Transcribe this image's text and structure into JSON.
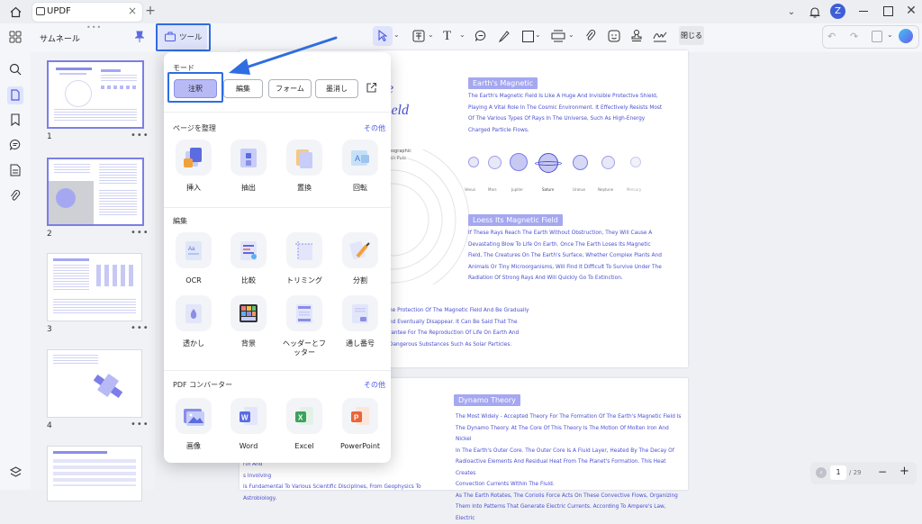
{
  "tab": {
    "title": "UPDF"
  },
  "window": {
    "avatar_letter": "Z"
  },
  "toolbar": {
    "tool_label": "ツール",
    "close_label": "閉じる"
  },
  "thumb_panel": {
    "title": "サムネール",
    "pages": [
      "1",
      "2",
      "3",
      "4"
    ]
  },
  "popup": {
    "mode_title": "モード",
    "modes": [
      "注釈",
      "編集",
      "フォーム",
      "墨消し"
    ],
    "organize_title": "ページを整理",
    "organize_more": "その他",
    "organize": [
      "挿入",
      "抽出",
      "置換",
      "回転"
    ],
    "edit_title": "編集",
    "edit_row1": [
      "OCR",
      "比較",
      "トリミング",
      "分割"
    ],
    "edit_row2": [
      "透かし",
      "背景",
      "ヘッダーとフッター",
      "通し番号"
    ],
    "converter_title": "PDF コンバーター",
    "converter_more": "その他",
    "converter": [
      "画像",
      "Word",
      "Excel",
      "PowerPoint"
    ]
  },
  "doc": {
    "page1": {
      "title_fragment_1": "e",
      "title_fragment_2": "ield",
      "section1_title": "Earth's Magnetic",
      "section1_text": "The Earth's Magnetic Field Is Like A Huge And Invisible Protective Shield,\nPlaying A Vital Role In The Cosmic Environment. It Effectively Resists Most\nOf The Various Types Of Rays In The Universe, Such As High-Energy\nCharged Particle Flows.",
      "geo_label": "eographic\nrth Pole",
      "planets": [
        "Venus",
        "Mars",
        "Jupiter",
        "Saturn",
        "Uranus",
        "Neptune",
        "Mercury"
      ],
      "section2_title": "Loess Its Magnetic Field",
      "section2_text": "If These Rays Reach The Earth Without Obstruction, They Will Cause A\nDevastating Blow To Life On Earth. Once The Earth Loses Its Magnetic\nField, The Creatures On The Earth's Surface, Whether Complex Plants And\nAnimals Or Tiny Microorganisms, Will Find It Difficult To Survive Under The\nRadiation Of Strong Rays And Will Quickly Go To Extinction.",
      "left_text": "he Protection Of The Magnetic Field And Be Gradually\nnd Eventually Disappear. It Can Be Said That The\nrantee For The Reproduction Of Life On Earth And\nDangerous Substances Such As Solar Particles."
    },
    "page2": {
      "section_title": "Dynamo Theory",
      "text": "The Most Widely - Accepted Theory For The Formation Of The Earth's Magnetic Field Is\nThe Dynamo Theory. At The Core Of This Theory Is The Motion Of Molten Iron And Nickel\nIn The Earth's Outer Core. The Outer Core Is A Fluid Layer, Heated By The Decay Of\nRadioactive Elements And Residual Heat From The Planet's Formation. This Heat Creates\nConvection Currents Within The Fluid.\nAs The Earth Rotates, The Coriolis Force Acts On These Convective Flows, Organizing\nThem Into Patterns That Generate Electric Currents. According To Ampere's Law, Electric",
      "left_text": "t, Has Long\nemic Radiation\nOn Earth And\nh Formation\nrth And\ns Involving\nis Fundamental To Various Scientific Disciplines, From Geophysics To\nAstrobiology."
    }
  },
  "zoom": {
    "page_current": "1",
    "page_total": "/ 29"
  }
}
